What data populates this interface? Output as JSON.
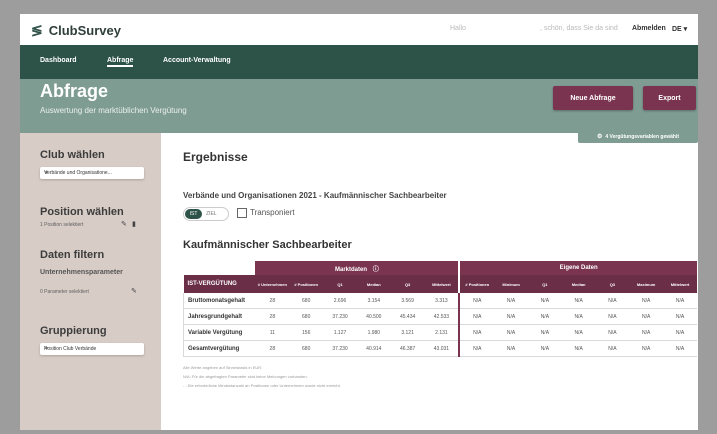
{
  "app": {
    "name": "ClubSurvey"
  },
  "topbar": {
    "greeting_a": "Hallo",
    "greeting_b": ", schön, dass Sie da sind",
    "logout": "Abmelden",
    "lang": "DE ▾"
  },
  "nav": {
    "items": [
      {
        "label": "Dashboard"
      },
      {
        "label": "Abfrage"
      },
      {
        "label": "Account-Verwaltung"
      }
    ]
  },
  "header": {
    "title": "Abfrage",
    "subtitle": "Auswertung der marktüblichen Vergütung",
    "new_query_label": "Neue Abfrage",
    "export_label": "Export"
  },
  "sidebar": {
    "club_heading": "Club wählen",
    "club_select": "Verbände und Organisatione...",
    "position_heading": "Position wählen",
    "position_note": "1 Position selektiert",
    "filter_heading": "Daten filtern",
    "company_params": "Unternehmensparameter",
    "params_note": "0 Parameter selektiert",
    "group_heading": "Gruppierung",
    "group_select": "Position Club Verbände"
  },
  "content": {
    "vars_badge": "4 Vergütungsvariablen gewählt",
    "results_heading": "Ergebnisse",
    "subtitle": "Verbände und Organisationen 2021 - Kaufmännischer Sachbearbeiter",
    "toggle_on": "IST",
    "toggle_off": "ZIEL",
    "transpose_label": "Transponiert",
    "table_heading": "Kaufmännischer Sachbearbeiter",
    "group_market": "Marktdaten",
    "group_own": "Eigene Daten",
    "columns": [
      "IST-VERGÜTUNG",
      "# Unternehmen",
      "# Positionen",
      "Q1",
      "Median",
      "Q3",
      "Mittelwert",
      "# Positionen",
      "Minimum",
      "Q1",
      "Median",
      "Q3",
      "Maximum",
      "Mittelwert"
    ],
    "rows": [
      {
        "label": "Bruttomonatsgehalt",
        "values": [
          "28",
          "680",
          "2.696",
          "3.154",
          "3.569",
          "3.313",
          "N/A",
          "N/A",
          "N/A",
          "N/A",
          "N/A",
          "N/A",
          "N/A"
        ]
      },
      {
        "label": "Jahresgrundgehalt",
        "values": [
          "28",
          "680",
          "37.230",
          "40.500",
          "45.434",
          "42.533",
          "N/A",
          "N/A",
          "N/A",
          "N/A",
          "N/A",
          "N/A",
          "N/A"
        ]
      },
      {
        "label": "Variable Vergütung",
        "values": [
          "11",
          "156",
          "1.127",
          "1.980",
          "3.121",
          "2.131",
          "N/A",
          "N/A",
          "N/A",
          "N/A",
          "N/A",
          "N/A",
          "N/A"
        ]
      },
      {
        "label": "Gesamtvergütung",
        "values": [
          "28",
          "680",
          "37.230",
          "40.914",
          "46.387",
          "43.031",
          "N/A",
          "N/A",
          "N/A",
          "N/A",
          "N/A",
          "N/A",
          "N/A"
        ]
      }
    ],
    "footnotes": [
      "Alle Werte angeben auf Sinnesbasis in EUR.",
      "N/A: Für die abgefragten Parameter sind keine Meinungen vorhanden.",
      "- : Die erforderliche Mindestanzahl an Positionen oder Unternehmen wurde nicht erreicht."
    ]
  },
  "colors": {
    "nav": "#2d5349",
    "band": "#7f9c93",
    "accent": "#7a3450",
    "sidebar": "#d7ccc6"
  }
}
